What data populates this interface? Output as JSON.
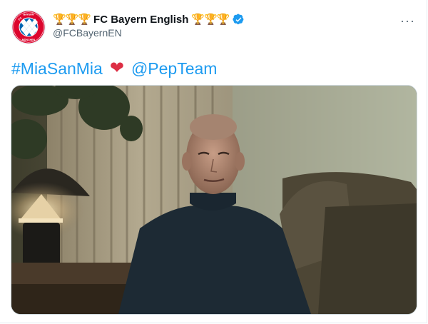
{
  "tweet": {
    "trophies_before": "🏆🏆🏆",
    "display_name": "FC Bayern English",
    "trophies_after": "🏆🏆🏆",
    "handle": "@FCBayernEN",
    "more_label": "···",
    "hashtag": "#MiaSanMia",
    "heart": "❤",
    "mention": "@PepTeam"
  },
  "logo": {
    "fc": "FC",
    "bayern": "BAYERN",
    "munchen": "MÜNCHEN"
  },
  "colors": {
    "link": "#1d9bf0",
    "verified": "#1d9bf0",
    "heart": "#dd2e44",
    "bayern_red": "#dc052d",
    "bayern_blue": "#0066b2"
  },
  "icons": {
    "verified": "verified-badge-icon",
    "more": "more-options-icon",
    "heart": "heart-emoji-icon",
    "trophy": "trophy-emoji-icon"
  }
}
